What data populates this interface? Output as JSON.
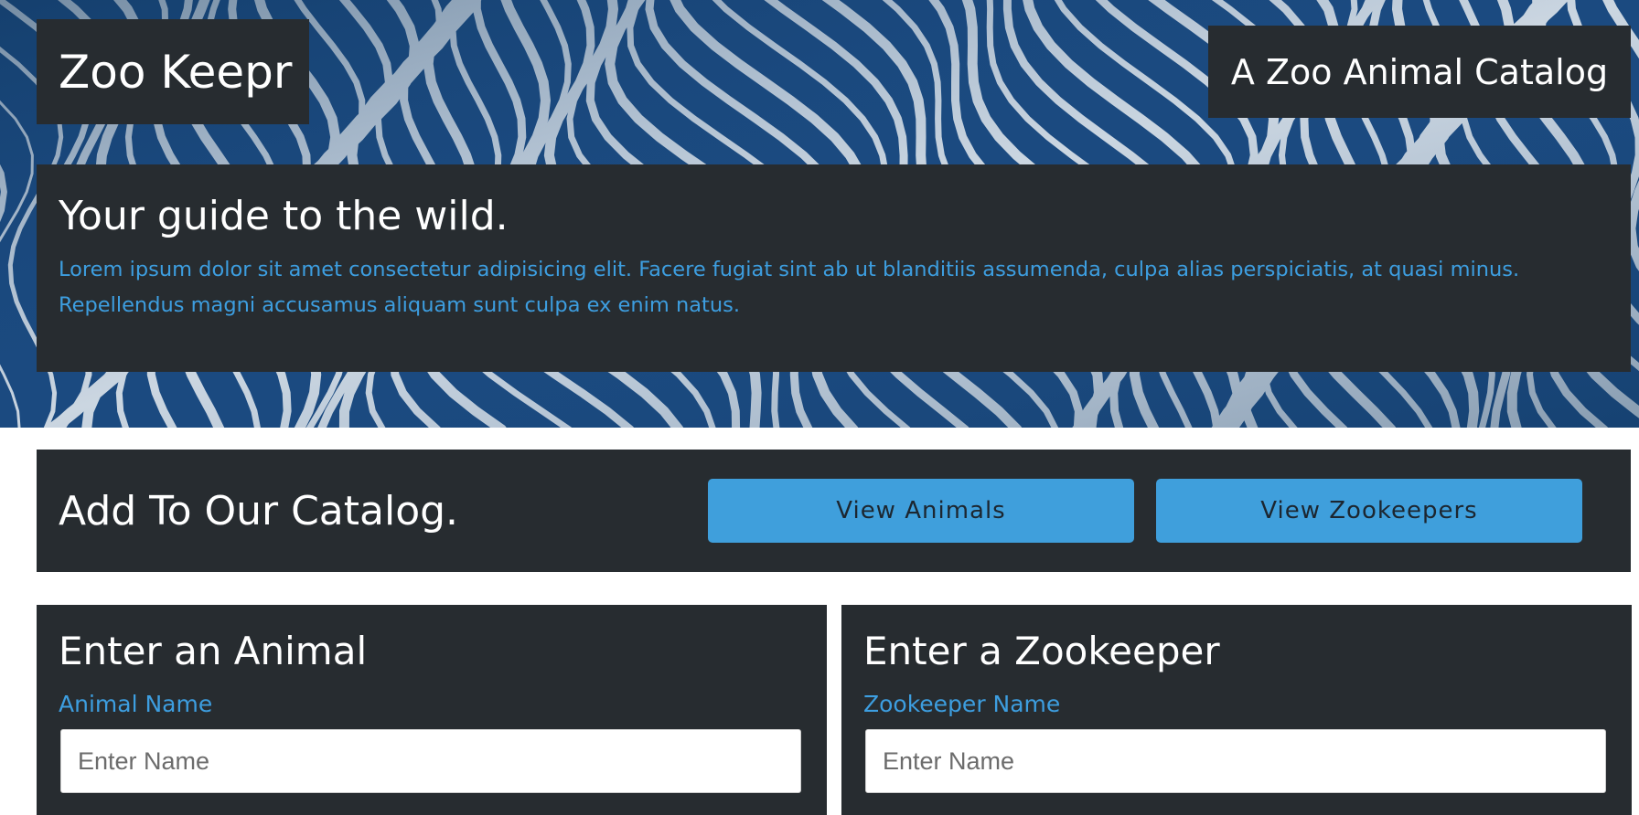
{
  "header": {
    "brand": "Zoo Keepr",
    "tagline": "A Zoo Animal Catalog"
  },
  "intro": {
    "heading": "Your guide to the wild.",
    "body": "Lorem ipsum dolor sit amet consectetur adipisicing elit. Facere fugiat sint ab ut blanditiis assumenda, culpa alias perspiciatis, at quasi minus. Repellendus magni accusamus aliquam sunt culpa ex enim natus."
  },
  "catalog": {
    "heading": "Add To Our Catalog.",
    "view_animals_label": "View Animals",
    "view_zookeepers_label": "View Zookeepers"
  },
  "animal_form": {
    "heading": "Enter an Animal",
    "name_label": "Animal Name",
    "name_placeholder": "Enter Name",
    "name_value": ""
  },
  "zookeeper_form": {
    "heading": "Enter a Zookeeper",
    "name_label": "Zookeeper Name",
    "name_placeholder": "Enter Name",
    "name_value": ""
  },
  "colors": {
    "panel_bg": "#272c30",
    "accent_blue": "#3f9fdc",
    "link_blue": "#3d9ee0",
    "hero_blue": "#1b4a80",
    "stripe_white": "#dfe6ec"
  }
}
